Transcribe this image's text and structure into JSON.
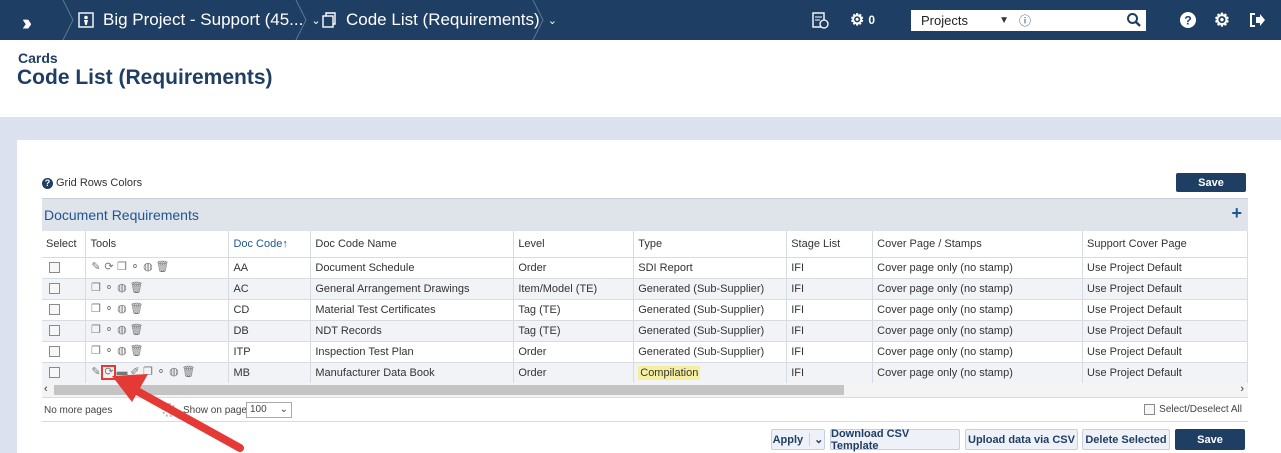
{
  "topbar": {
    "project_label": "Big Project - Support (45...",
    "page_label": "Code List (Requirements)",
    "notification_count": "0",
    "scope_select": "Projects",
    "search_placeholder": ""
  },
  "header": {
    "section": "Cards",
    "title": "Code List (Requirements)"
  },
  "grid": {
    "rows_colors_label": "Grid Rows Colors",
    "save_top": "Save",
    "section_title": "Document Requirements",
    "add_label": "+",
    "columns": [
      "Select",
      "Tools",
      "Doc Code",
      "Doc Code Name",
      "Level",
      "Type",
      "Stage List",
      "Cover Page / Stamps",
      "Support Cover Page"
    ],
    "sort_indicator": "↑",
    "rows": [
      {
        "code": "AA",
        "name": "Document Schedule",
        "level": "Order",
        "type": "SDI Report",
        "stage": "IFI",
        "cover": "Cover page only (no stamp)",
        "support": "Use Project Default"
      },
      {
        "code": "AC",
        "name": "General Arrangement Drawings",
        "level": "Item/Model (TE)",
        "type": "Generated (Sub-Supplier)",
        "stage": "IFI",
        "cover": "Cover page only (no stamp)",
        "support": "Use Project Default"
      },
      {
        "code": "CD",
        "name": "Material Test Certificates",
        "level": "Tag (TE)",
        "type": "Generated (Sub-Supplier)",
        "stage": "IFI",
        "cover": "Cover page only (no stamp)",
        "support": "Use Project Default"
      },
      {
        "code": "DB",
        "name": "NDT Records",
        "level": "Tag (TE)",
        "type": "Generated (Sub-Supplier)",
        "stage": "IFI",
        "cover": "Cover page only (no stamp)",
        "support": "Use Project Default"
      },
      {
        "code": "ITP",
        "name": "Inspection Test Plan",
        "level": "Order",
        "type": "Generated (Sub-Supplier)",
        "stage": "IFI",
        "cover": "Cover page only (no stamp)",
        "support": "Use Project Default"
      },
      {
        "code": "MB",
        "name": "Manufacturer Data Book",
        "level": "Order",
        "type": "Compilation",
        "stage": "IFI",
        "cover": "Cover page only (no stamp)",
        "support": "Use Project Default"
      }
    ],
    "pager_text": "No more pages",
    "show_on_page": "Show on page:",
    "page_size": "100",
    "select_all": "Select/Deselect All"
  },
  "footer": {
    "apply": "Apply",
    "download_csv": "Download CSV Template",
    "upload_csv": "Upload data via CSV",
    "delete_selected": "Delete Selected",
    "save_bottom": "Save"
  },
  "colors": {
    "navy": "#1f3e63",
    "band": "#dbe1ee",
    "highlight": "#f5f0a0",
    "annotation": "#e53935"
  }
}
